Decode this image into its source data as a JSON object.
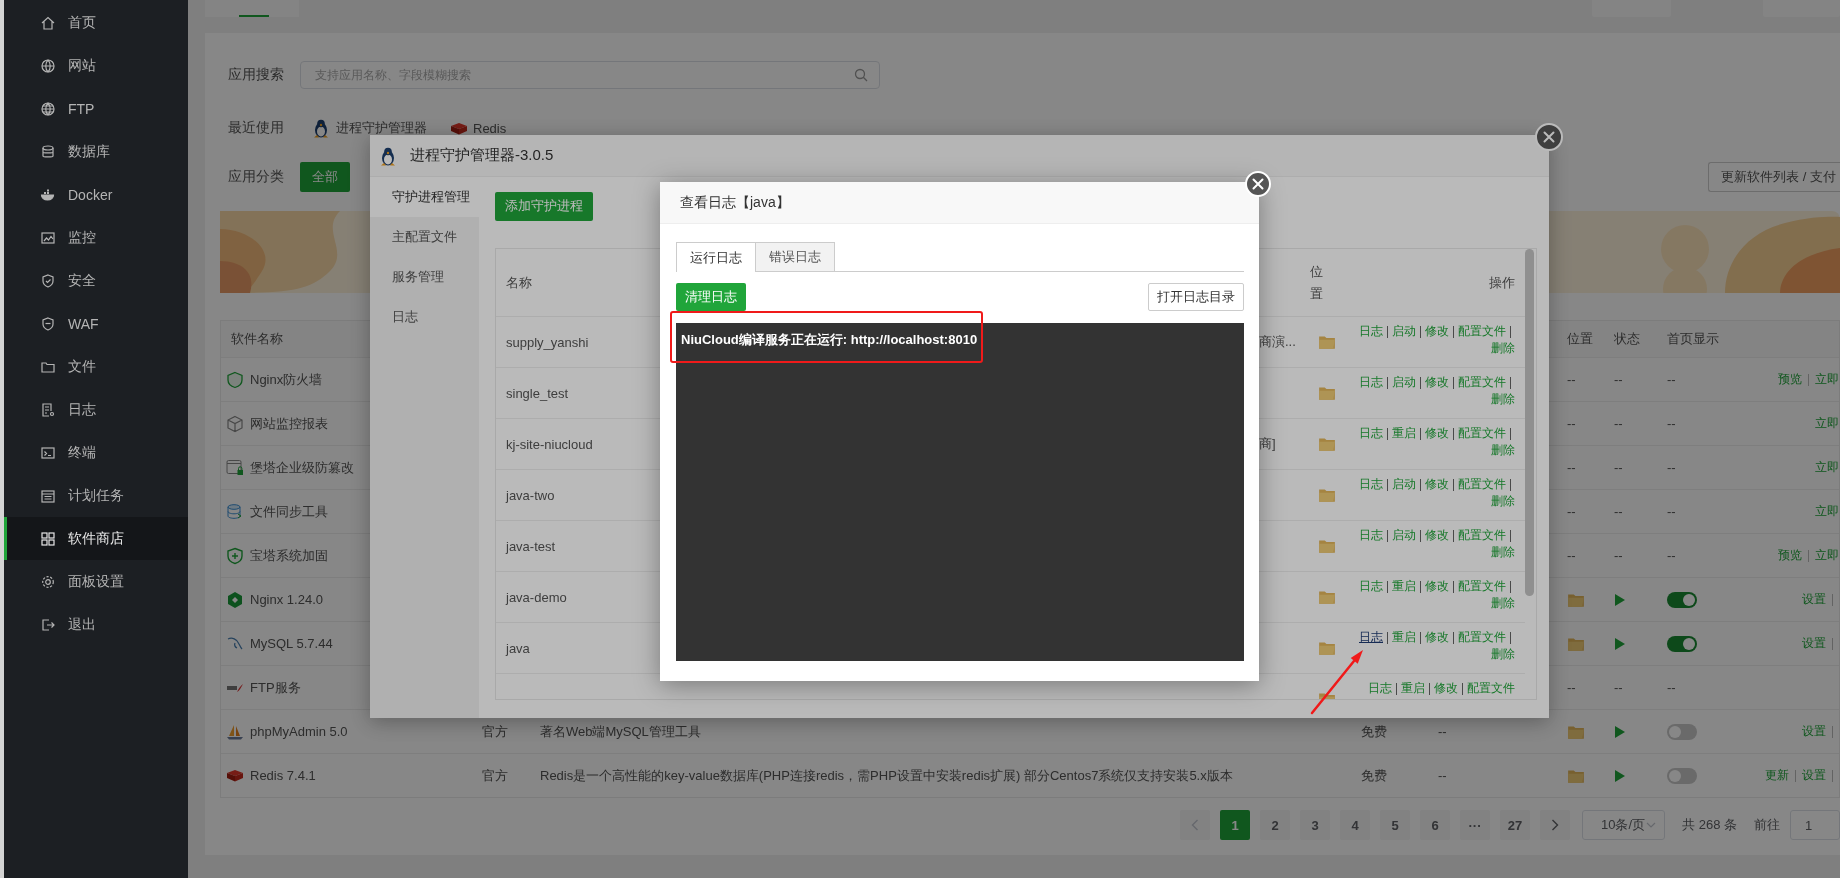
{
  "sidebar": {
    "items": [
      {
        "label": "首页",
        "selected": false
      },
      {
        "label": "网站",
        "selected": false
      },
      {
        "label": "FTP",
        "selected": false
      },
      {
        "label": "数据库",
        "selected": false
      },
      {
        "label": "Docker",
        "selected": false
      },
      {
        "label": "监控",
        "selected": false
      },
      {
        "label": "安全",
        "selected": false
      },
      {
        "label": "WAF",
        "selected": false
      },
      {
        "label": "文件",
        "selected": false
      },
      {
        "label": "日志",
        "selected": false
      },
      {
        "label": "终端",
        "selected": false
      },
      {
        "label": "计划任务",
        "selected": false
      },
      {
        "label": "软件商店",
        "selected": true
      },
      {
        "label": "面板设置",
        "selected": false
      },
      {
        "label": "退出",
        "selected": false
      }
    ]
  },
  "app_store": {
    "search": {
      "label": "应用搜索",
      "placeholder": "支持应用名称、字段模糊搜索"
    },
    "recent": {
      "label": "最近使用",
      "items": [
        "进程守护管理器",
        "Redis"
      ]
    },
    "category": {
      "label": "应用分类",
      "items": [
        {
          "label": "全部",
          "selected": true
        }
      ]
    },
    "update_button": "更新软件列表 / 支付",
    "table": {
      "columns": {
        "name": "软件名称",
        "location": "位置",
        "status": "状态",
        "home_display": "首页显示"
      },
      "rows": [
        {
          "name": "Nginx防火墙",
          "location": {
            "kind": "text",
            "text": "--"
          },
          "status": {
            "kind": "text",
            "text": "--"
          },
          "home_display": {
            "kind": "text",
            "text": "--"
          },
          "actions": [
            "预览",
            "立即"
          ],
          "more_actions": false
        },
        {
          "name": "网站监控报表",
          "location": {
            "kind": "text",
            "text": "--"
          },
          "status": {
            "kind": "text",
            "text": "--"
          },
          "home_display": {
            "kind": "text",
            "text": "--"
          },
          "actions": [
            "立即"
          ],
          "more_actions": false
        },
        {
          "name": "堡塔企业级防篡改",
          "location": {
            "kind": "text",
            "text": "--"
          },
          "status": {
            "kind": "text",
            "text": "--"
          },
          "home_display": {
            "kind": "text",
            "text": "--"
          },
          "actions": [
            "立即"
          ],
          "more_actions": false
        },
        {
          "name": "文件同步工具",
          "location": {
            "kind": "text",
            "text": "--"
          },
          "status": {
            "kind": "text",
            "text": "--"
          },
          "home_display": {
            "kind": "text",
            "text": "--"
          },
          "actions": [
            "立即"
          ],
          "more_actions": false
        },
        {
          "name": "宝塔系统加固",
          "location": {
            "kind": "text",
            "text": "--"
          },
          "status": {
            "kind": "text",
            "text": "--"
          },
          "home_display": {
            "kind": "text",
            "text": "--"
          },
          "actions": [
            "预览",
            "立即"
          ],
          "more_actions": false
        },
        {
          "name": "Nginx 1.24.0",
          "location": {
            "kind": "folder"
          },
          "status": {
            "kind": "play"
          },
          "home_display": {
            "kind": "toggle",
            "on": true
          },
          "actions": [
            "设置"
          ],
          "more_actions": true
        },
        {
          "name": "MySQL 5.7.44",
          "location": {
            "kind": "folder"
          },
          "status": {
            "kind": "play"
          },
          "home_display": {
            "kind": "toggle",
            "on": true
          },
          "actions": [
            "设置"
          ],
          "more_actions": true
        },
        {
          "name": "FTP服务",
          "location": {
            "kind": "text",
            "text": "--"
          },
          "status": {
            "kind": "text",
            "text": "--"
          },
          "home_display": {
            "kind": "text",
            "text": "--"
          }
        },
        {
          "name": "phpMyAdmin 5.0",
          "type": "官方",
          "description": "著名Web端MySQL管理工具",
          "price": "免费",
          "expiry": "--",
          "location": {
            "kind": "folder"
          },
          "status": {
            "kind": "play"
          },
          "home_display": {
            "kind": "toggle",
            "on": false
          },
          "actions": [
            "设置"
          ],
          "more_actions": true
        },
        {
          "name": "Redis 7.4.1",
          "type": "官方",
          "description": "Redis是一个高性能的key-value数据库(PHP连接redis，需PHP设置中安装redis扩展) 部分Centos7系统仅支持安装5.x版本",
          "price": "免费",
          "expiry": "--",
          "location": {
            "kind": "folder"
          },
          "status": {
            "kind": "play"
          },
          "home_display": {
            "kind": "toggle",
            "on": false
          },
          "actions": [
            "更新",
            "设置"
          ],
          "more_actions": true
        }
      ]
    },
    "pagination": {
      "pages": [
        {
          "label": "1",
          "selected": true
        },
        {
          "label": "2",
          "selected": false
        },
        {
          "label": "3",
          "selected": false
        },
        {
          "label": "4",
          "selected": false
        },
        {
          "label": "5",
          "selected": false
        },
        {
          "label": "6",
          "selected": false
        },
        {
          "label": "···",
          "selected": false
        },
        {
          "label": "27",
          "selected": false
        }
      ],
      "page_size": "10条/页",
      "total": "共 268 条",
      "goto_label": "前往",
      "goto_value": "1"
    }
  },
  "process_manager": {
    "title": "进程守护管理器-3.0.5",
    "menu": [
      {
        "label": "守护进程管理",
        "selected": true
      },
      {
        "label": "主配置文件",
        "selected": false
      },
      {
        "label": "服务管理",
        "selected": false
      },
      {
        "label": "日志",
        "selected": false
      }
    ],
    "add_button": "添加守护进程",
    "columns": {
      "name": "名称",
      "location": "位置",
      "actions": "操作"
    },
    "rows": [
      {
        "name": "supply_yanshi",
        "column_3": "商演...",
        "actions": [
          {
            "label": "日志",
            "hovered": false
          },
          {
            "label": "启动",
            "hovered": false
          },
          {
            "label": "修改",
            "hovered": false
          },
          {
            "label": "配置文件",
            "hovered": false
          },
          {
            "label": "删除",
            "hovered": false
          }
        ]
      },
      {
        "name": "single_test",
        "actions": [
          {
            "label": "日志",
            "hovered": false
          },
          {
            "label": "启动",
            "hovered": false
          },
          {
            "label": "修改",
            "hovered": false
          },
          {
            "label": "配置文件",
            "hovered": false
          },
          {
            "label": "删除",
            "hovered": false
          }
        ]
      },
      {
        "name": "kj-site-niucloud",
        "column_3": "商]",
        "actions": [
          {
            "label": "日志",
            "hovered": false
          },
          {
            "label": "重启",
            "hovered": false
          },
          {
            "label": "修改",
            "hovered": false
          },
          {
            "label": "配置文件",
            "hovered": false
          },
          {
            "label": "删除",
            "hovered": false
          }
        ]
      },
      {
        "name": "java-two",
        "actions": [
          {
            "label": "日志",
            "hovered": false
          },
          {
            "label": "启动",
            "hovered": false
          },
          {
            "label": "修改",
            "hovered": false
          },
          {
            "label": "配置文件",
            "hovered": false
          },
          {
            "label": "删除",
            "hovered": false
          }
        ]
      },
      {
        "name": "java-test",
        "actions": [
          {
            "label": "日志",
            "hovered": false
          },
          {
            "label": "启动",
            "hovered": false
          },
          {
            "label": "修改",
            "hovered": false
          },
          {
            "label": "配置文件",
            "hovered": false
          },
          {
            "label": "删除",
            "hovered": false
          }
        ]
      },
      {
        "name": "java-demo",
        "actions": [
          {
            "label": "日志",
            "hovered": false
          },
          {
            "label": "重启",
            "hovered": false
          },
          {
            "label": "修改",
            "hovered": false
          },
          {
            "label": "配置文件",
            "hovered": false
          },
          {
            "label": "删除",
            "hovered": false
          }
        ]
      },
      {
        "name": "java",
        "actions": [
          {
            "label": "日志",
            "hovered": true
          },
          {
            "label": "重启",
            "hovered": false
          },
          {
            "label": "修改",
            "hovered": false
          },
          {
            "label": "配置文件",
            "hovered": false
          },
          {
            "label": "删除",
            "hovered": false
          }
        ]
      },
      {
        "actions": [
          {
            "label": "日志",
            "hovered": false
          },
          {
            "label": "重启",
            "hovered": false
          },
          {
            "label": "修改",
            "hovered": false
          },
          {
            "label": "配置文件",
            "hovered": false
          }
        ]
      }
    ]
  },
  "log_dialog": {
    "title": "查看日志【java】",
    "tabs": [
      {
        "label": "运行日志",
        "selected": true
      },
      {
        "label": "错误日志",
        "selected": false
      }
    ],
    "clear_button": "清理日志",
    "open_dir_button": "打开日志目录",
    "log_lines": [
      "NiuCloud编译服务正在运行: http://localhost:8010"
    ]
  },
  "annotations": [
    {
      "kind": "frame"
    },
    {
      "kind": "arrow"
    }
  ]
}
